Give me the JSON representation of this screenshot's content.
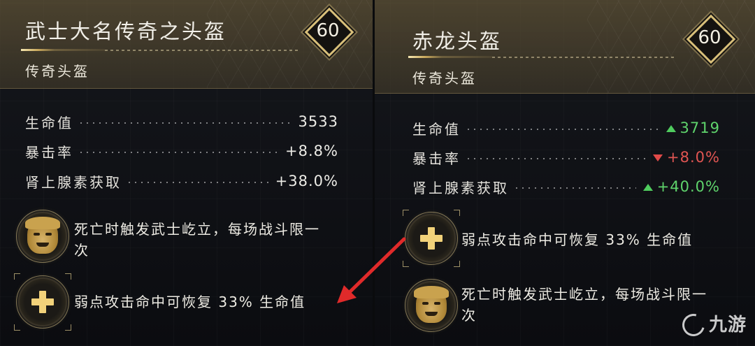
{
  "left_item": {
    "name": "武士大名传奇之头盔",
    "type": "传奇头盔",
    "level": "60",
    "stats": [
      {
        "label": "生命值",
        "value": "3533"
      },
      {
        "label": "暴击率",
        "value": "+8.8%"
      },
      {
        "label": "肾上腺素获取",
        "value": "+38.0%"
      }
    ],
    "perks": [
      {
        "icon": "samurai-mask-icon",
        "text": "死亡时触发武士屹立，每场战斗限一次"
      },
      {
        "icon": "health-plus-icon",
        "text": "弱点攻击命中可恢复 33% 生命值"
      }
    ]
  },
  "right_item": {
    "name": "赤龙头盔",
    "type": "传奇头盔",
    "level": "60",
    "stats": [
      {
        "label": "生命值",
        "value": "3719",
        "trend": "up"
      },
      {
        "label": "暴击率",
        "value": "+8.0%",
        "trend": "down"
      },
      {
        "label": "肾上腺素获取",
        "value": "+40.0%",
        "trend": "up"
      }
    ],
    "perks": [
      {
        "icon": "health-plus-icon",
        "text": "弱点攻击命中可恢复 33% 生命值"
      },
      {
        "icon": "samurai-mask-icon",
        "text": "死亡时触发武士屹立，每场战斗限一次"
      }
    ]
  },
  "colors": {
    "up": "#5fd46c",
    "down": "#e05552",
    "gold": "#d8bf7a",
    "annotation_arrow": "#e02a2a"
  },
  "watermark": "九游"
}
